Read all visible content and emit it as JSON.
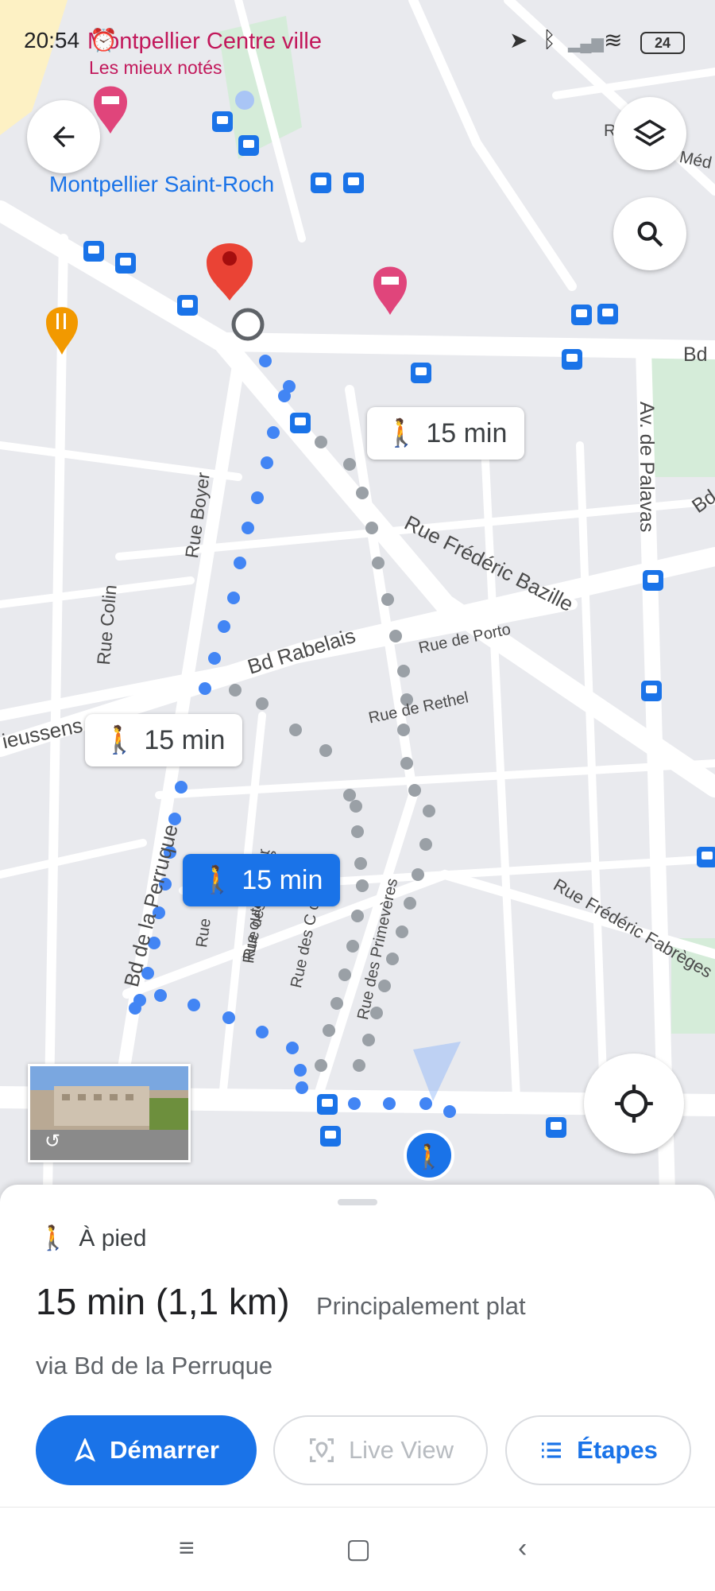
{
  "status_bar": {
    "time": "20:54",
    "battery": "24"
  },
  "map": {
    "place_title": "Montpellier Centre ville",
    "place_subtitle": "Les mieux notés",
    "station_label": "Montpellier Saint-Roch",
    "streets": {
      "rue_boyer": "Rue Boyer",
      "rue_colin": "Rue Colin",
      "bd_rabelais": "Bd Rabelais",
      "rue_de_porto": "Rue de Porto",
      "rue_de_rethel": "Rue de Rethel",
      "rue_frederic_bazille": "Rue Frédéric Bazille",
      "av_de_palavas": "Av. de Palavas",
      "bd_la_perruque": "Bd de la Perruque",
      "rue_frederic_fabreges": "Rue Frédéric Fabrèges",
      "vieussens": "ieussens",
      "bd_top": "Bd",
      "bd_mid": "Bd",
      "med": "Méd",
      "r_label": "R",
      "rue_des_primeveres": "Rue des Primevères",
      "rue_des_c": "Rue des C   cots",
      "rue_des_gerettes": "Rue des   erettes",
      "rue_boutons_dor": "Rue   outons d'Or",
      "rue_left": "Rue"
    },
    "route_chips": [
      {
        "label": "15 min",
        "selected": false
      },
      {
        "label": "15 min",
        "selected": false
      },
      {
        "label": "15 min",
        "selected": true
      }
    ]
  },
  "sheet": {
    "mode_label": "À pied",
    "duration": "15 min (1,1 km)",
    "terrain": "Principalement plat",
    "via": "via Bd de la Perruque",
    "start_button": "Démarrer",
    "live_view_button": "Live View",
    "steps_button": "Étapes"
  },
  "icons": {
    "back": "back-arrow-icon",
    "layers": "layers-icon",
    "search": "search-icon",
    "location": "my-location-icon",
    "walk": "walking-person-icon"
  },
  "colors": {
    "primary_route": "#4285f4",
    "alt_route": "#9aa0a6",
    "accent": "#1a73e8",
    "pin": "#ea4335",
    "poi_pink": "#e0457b"
  }
}
